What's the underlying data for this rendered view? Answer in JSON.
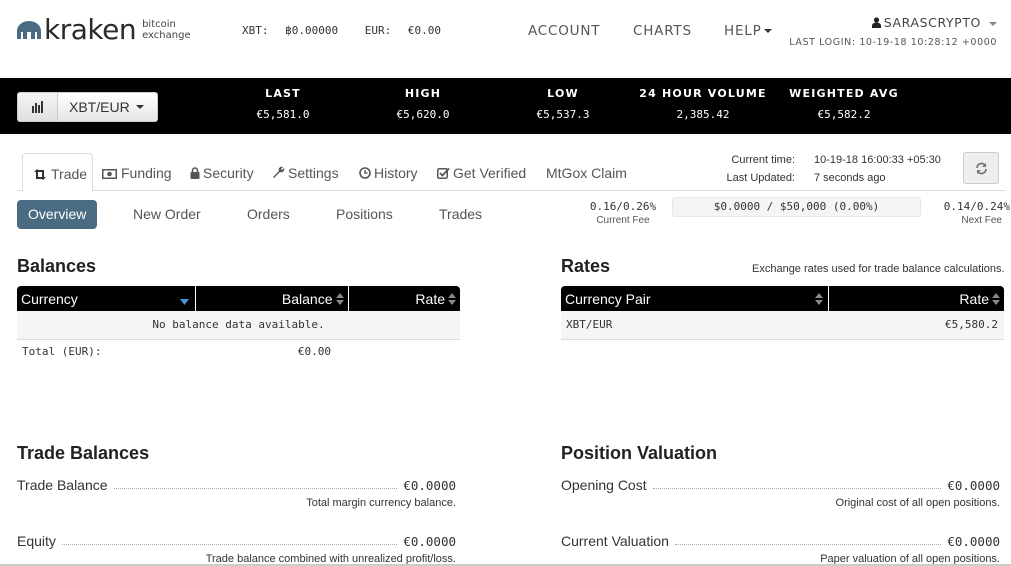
{
  "header": {
    "logo_word": "kraken",
    "logo_sub_line1": "bitcoin",
    "logo_sub_line2": "exchange",
    "balances": [
      {
        "label": "XBT:",
        "value": "฿0.00000"
      },
      {
        "label": "EUR:",
        "value": "€0.00"
      }
    ],
    "nav": [
      {
        "label": "ACCOUNT"
      },
      {
        "label": "CHARTS"
      },
      {
        "label": "HELP"
      }
    ],
    "user": "SARASCRYPTO",
    "last_login": "LAST LOGIN: 10-19-18 10:28:12 +0000"
  },
  "ticker": {
    "pair": "XBT/EUR",
    "stats": [
      {
        "label": "LAST",
        "value": "€5,581.0"
      },
      {
        "label": "HIGH",
        "value": "€5,620.0"
      },
      {
        "label": "LOW",
        "value": "€5,537.3"
      },
      {
        "label": "24 HOUR VOLUME",
        "value": "2,385.42"
      },
      {
        "label": "WEIGHTED AVG",
        "value": "€5,582.2"
      }
    ]
  },
  "tabs": [
    {
      "label": "Trade",
      "icon": "retweet-icon",
      "active": true
    },
    {
      "label": "Funding",
      "icon": "money-icon"
    },
    {
      "label": "Security",
      "icon": "lock-icon"
    },
    {
      "label": "Settings",
      "icon": "wrench-icon"
    },
    {
      "label": "History",
      "icon": "clock-icon"
    },
    {
      "label": "Get Verified",
      "icon": "check-square-icon"
    },
    {
      "label": "MtGox Claim"
    }
  ],
  "time_info": {
    "current_label": "Current time:",
    "current_value": "10-19-18 16:00:33 +05:30",
    "updated_label": "Last Updated:",
    "updated_value": "7 seconds ago"
  },
  "subnav": [
    {
      "label": "Overview",
      "active": true
    },
    {
      "label": "New Order"
    },
    {
      "label": "Orders"
    },
    {
      "label": "Positions"
    },
    {
      "label": "Trades"
    }
  ],
  "fees": {
    "current_value": "0.16/0.26%",
    "current_label": "Current Fee",
    "volume_text": "$0.0000 / $50,000 (0.00%)",
    "volume_progress_percent": 0,
    "next_value": "0.14/0.24%",
    "next_label": "Next Fee"
  },
  "balances": {
    "title": "Balances",
    "columns": [
      "Currency",
      "Balance",
      "Rate"
    ],
    "empty_text": "No balance data available.",
    "total_label": "Total (EUR):",
    "total_value": "€0.00"
  },
  "rates": {
    "title": "Rates",
    "note": "Exchange rates used for trade balance calculations.",
    "columns": [
      "Currency Pair",
      "Rate"
    ],
    "rows": [
      {
        "pair": "XBT/EUR",
        "rate": "€5,580.2"
      }
    ]
  },
  "trade_balances": {
    "title": "Trade Balances",
    "items": [
      {
        "label": "Trade Balance",
        "value": "€0.0000",
        "desc": "Total margin currency balance."
      },
      {
        "label": "Equity",
        "value": "€0.0000",
        "desc": "Trade balance combined with unrealized profit/loss."
      }
    ]
  },
  "position_valuation": {
    "title": "Position Valuation",
    "items": [
      {
        "label": "Opening Cost",
        "value": "€0.0000",
        "desc": "Original cost of all open positions."
      },
      {
        "label": "Current Valuation",
        "value": "€0.0000",
        "desc": "Paper valuation of all open positions."
      }
    ]
  },
  "colors": {
    "brand": "#4b6b82",
    "ticker_bg": "#000000"
  }
}
